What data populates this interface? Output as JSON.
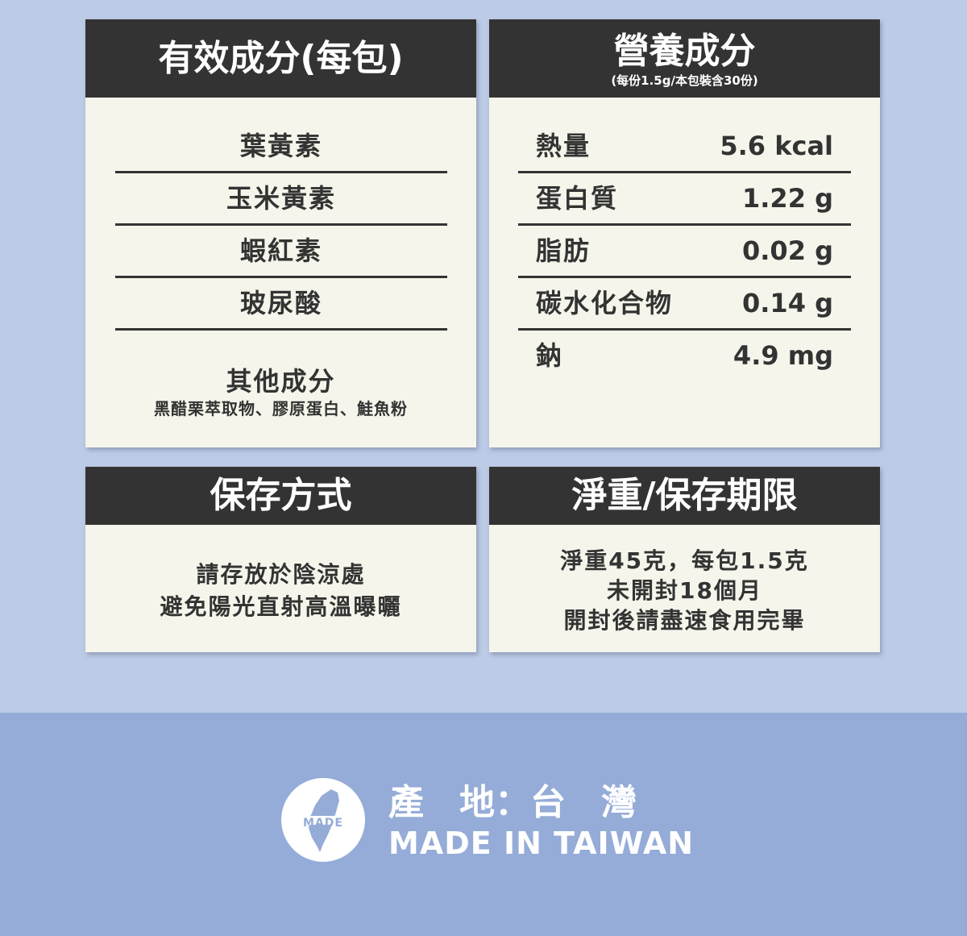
{
  "ingredients": {
    "title": "有效成分(每包)",
    "items": [
      "葉黃素",
      "玉米黃素",
      "蝦紅素",
      "玻尿酸"
    ],
    "other_title": "其他成分",
    "other_text": "黑醋栗萃取物、膠原蛋白、鮭魚粉"
  },
  "nutrition": {
    "title": "營養成分",
    "subtitle": "(每份1.5g/本包裝含30份)",
    "rows": [
      {
        "name": "熱量",
        "value": "5.6 kcal"
      },
      {
        "name": "蛋白質",
        "value": "1.22 g"
      },
      {
        "name": "脂肪",
        "value": "0.02 g"
      },
      {
        "name": "碳水化合物",
        "value": "0.14 g"
      },
      {
        "name": "鈉",
        "value": "4.9 mg"
      }
    ]
  },
  "storage": {
    "title": "保存方式",
    "line1": "請存放於陰涼處",
    "line2": "避免陽光直射高溫曝曬"
  },
  "weight": {
    "title": "淨重/保存期限",
    "line1": "淨重45克，每包1.5克",
    "line2": "未開封18個月",
    "line3": "開封後請盡速食用完畢"
  },
  "footer": {
    "badge_text": "MADE",
    "origin": "產　地：台　灣",
    "made_in": "MADE IN TAIWAN",
    "colors": {
      "background": "#95acd8",
      "text": "#ffffff"
    }
  },
  "colors": {
    "page_background": "#bccbe6",
    "card_background": "#f6f5eb",
    "header_background": "#333333"
  }
}
